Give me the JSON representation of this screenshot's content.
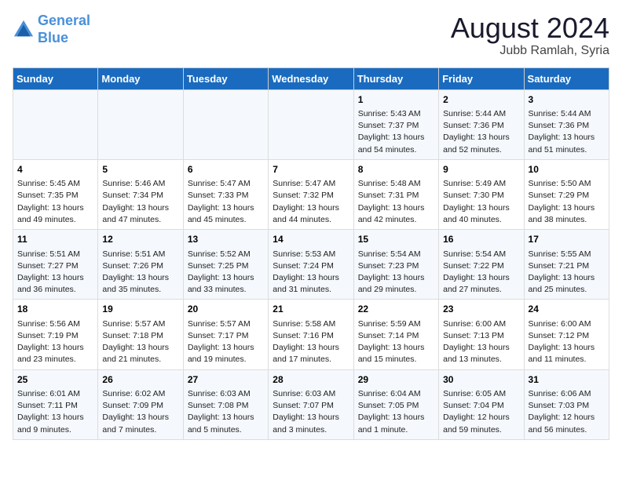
{
  "header": {
    "logo_line1": "General",
    "logo_line2": "Blue",
    "main_title": "August 2024",
    "sub_title": "Jubb Ramlah, Syria"
  },
  "weekdays": [
    "Sunday",
    "Monday",
    "Tuesday",
    "Wednesday",
    "Thursday",
    "Friday",
    "Saturday"
  ],
  "weeks": [
    [
      {
        "day": "",
        "info": ""
      },
      {
        "day": "",
        "info": ""
      },
      {
        "day": "",
        "info": ""
      },
      {
        "day": "",
        "info": ""
      },
      {
        "day": "1",
        "info": "Sunrise: 5:43 AM\nSunset: 7:37 PM\nDaylight: 13 hours\nand 54 minutes."
      },
      {
        "day": "2",
        "info": "Sunrise: 5:44 AM\nSunset: 7:36 PM\nDaylight: 13 hours\nand 52 minutes."
      },
      {
        "day": "3",
        "info": "Sunrise: 5:44 AM\nSunset: 7:36 PM\nDaylight: 13 hours\nand 51 minutes."
      }
    ],
    [
      {
        "day": "4",
        "info": "Sunrise: 5:45 AM\nSunset: 7:35 PM\nDaylight: 13 hours\nand 49 minutes."
      },
      {
        "day": "5",
        "info": "Sunrise: 5:46 AM\nSunset: 7:34 PM\nDaylight: 13 hours\nand 47 minutes."
      },
      {
        "day": "6",
        "info": "Sunrise: 5:47 AM\nSunset: 7:33 PM\nDaylight: 13 hours\nand 45 minutes."
      },
      {
        "day": "7",
        "info": "Sunrise: 5:47 AM\nSunset: 7:32 PM\nDaylight: 13 hours\nand 44 minutes."
      },
      {
        "day": "8",
        "info": "Sunrise: 5:48 AM\nSunset: 7:31 PM\nDaylight: 13 hours\nand 42 minutes."
      },
      {
        "day": "9",
        "info": "Sunrise: 5:49 AM\nSunset: 7:30 PM\nDaylight: 13 hours\nand 40 minutes."
      },
      {
        "day": "10",
        "info": "Sunrise: 5:50 AM\nSunset: 7:29 PM\nDaylight: 13 hours\nand 38 minutes."
      }
    ],
    [
      {
        "day": "11",
        "info": "Sunrise: 5:51 AM\nSunset: 7:27 PM\nDaylight: 13 hours\nand 36 minutes."
      },
      {
        "day": "12",
        "info": "Sunrise: 5:51 AM\nSunset: 7:26 PM\nDaylight: 13 hours\nand 35 minutes."
      },
      {
        "day": "13",
        "info": "Sunrise: 5:52 AM\nSunset: 7:25 PM\nDaylight: 13 hours\nand 33 minutes."
      },
      {
        "day": "14",
        "info": "Sunrise: 5:53 AM\nSunset: 7:24 PM\nDaylight: 13 hours\nand 31 minutes."
      },
      {
        "day": "15",
        "info": "Sunrise: 5:54 AM\nSunset: 7:23 PM\nDaylight: 13 hours\nand 29 minutes."
      },
      {
        "day": "16",
        "info": "Sunrise: 5:54 AM\nSunset: 7:22 PM\nDaylight: 13 hours\nand 27 minutes."
      },
      {
        "day": "17",
        "info": "Sunrise: 5:55 AM\nSunset: 7:21 PM\nDaylight: 13 hours\nand 25 minutes."
      }
    ],
    [
      {
        "day": "18",
        "info": "Sunrise: 5:56 AM\nSunset: 7:19 PM\nDaylight: 13 hours\nand 23 minutes."
      },
      {
        "day": "19",
        "info": "Sunrise: 5:57 AM\nSunset: 7:18 PM\nDaylight: 13 hours\nand 21 minutes."
      },
      {
        "day": "20",
        "info": "Sunrise: 5:57 AM\nSunset: 7:17 PM\nDaylight: 13 hours\nand 19 minutes."
      },
      {
        "day": "21",
        "info": "Sunrise: 5:58 AM\nSunset: 7:16 PM\nDaylight: 13 hours\nand 17 minutes."
      },
      {
        "day": "22",
        "info": "Sunrise: 5:59 AM\nSunset: 7:14 PM\nDaylight: 13 hours\nand 15 minutes."
      },
      {
        "day": "23",
        "info": "Sunrise: 6:00 AM\nSunset: 7:13 PM\nDaylight: 13 hours\nand 13 minutes."
      },
      {
        "day": "24",
        "info": "Sunrise: 6:00 AM\nSunset: 7:12 PM\nDaylight: 13 hours\nand 11 minutes."
      }
    ],
    [
      {
        "day": "25",
        "info": "Sunrise: 6:01 AM\nSunset: 7:11 PM\nDaylight: 13 hours\nand 9 minutes."
      },
      {
        "day": "26",
        "info": "Sunrise: 6:02 AM\nSunset: 7:09 PM\nDaylight: 13 hours\nand 7 minutes."
      },
      {
        "day": "27",
        "info": "Sunrise: 6:03 AM\nSunset: 7:08 PM\nDaylight: 13 hours\nand 5 minutes."
      },
      {
        "day": "28",
        "info": "Sunrise: 6:03 AM\nSunset: 7:07 PM\nDaylight: 13 hours\nand 3 minutes."
      },
      {
        "day": "29",
        "info": "Sunrise: 6:04 AM\nSunset: 7:05 PM\nDaylight: 13 hours\nand 1 minute."
      },
      {
        "day": "30",
        "info": "Sunrise: 6:05 AM\nSunset: 7:04 PM\nDaylight: 12 hours\nand 59 minutes."
      },
      {
        "day": "31",
        "info": "Sunrise: 6:06 AM\nSunset: 7:03 PM\nDaylight: 12 hours\nand 56 minutes."
      }
    ]
  ]
}
